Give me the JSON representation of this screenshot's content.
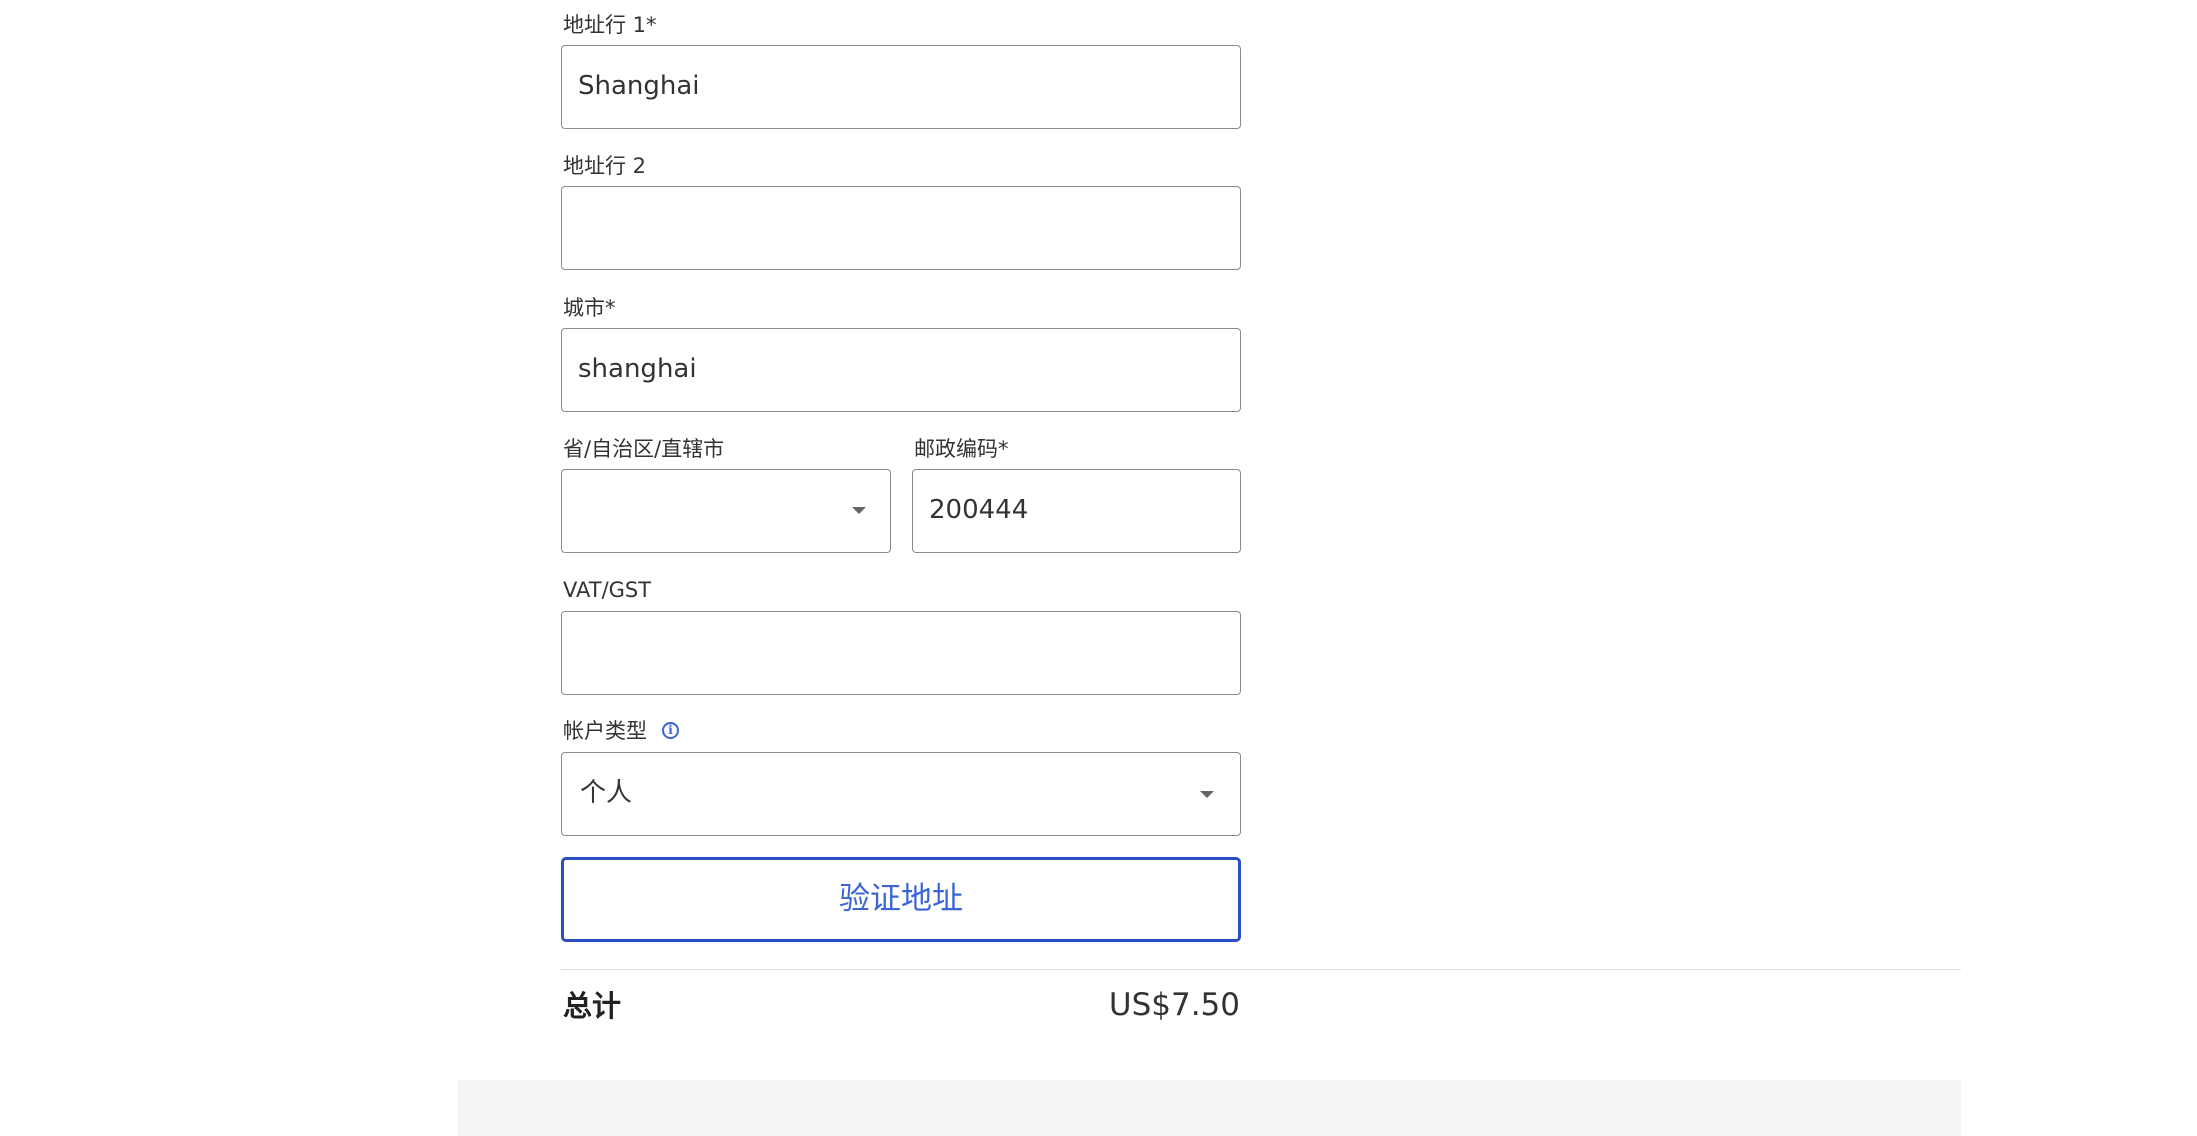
{
  "form": {
    "address1": {
      "label": "地址行 1*",
      "value": "Shanghai"
    },
    "address2": {
      "label": "地址行 2",
      "value": ""
    },
    "city": {
      "label": "城市*",
      "value": "shanghai"
    },
    "province": {
      "label": "省/自治区/直辖市",
      "value": ""
    },
    "postal_code": {
      "label": "邮政编码*",
      "value": "200444"
    },
    "vat": {
      "label": "VAT/GST",
      "value": ""
    },
    "account_type": {
      "label": "帐户类型",
      "value": "个人",
      "info_icon": "info-icon"
    },
    "verify_label": "验证地址"
  },
  "summary": {
    "total_label": "总计",
    "total_value": "US$7.50"
  },
  "colors": {
    "accent": "#3a64d8",
    "button_border": "#2a4fc4",
    "input_border": "#8a8a8a",
    "footer_bg": "#f4f4f4"
  }
}
